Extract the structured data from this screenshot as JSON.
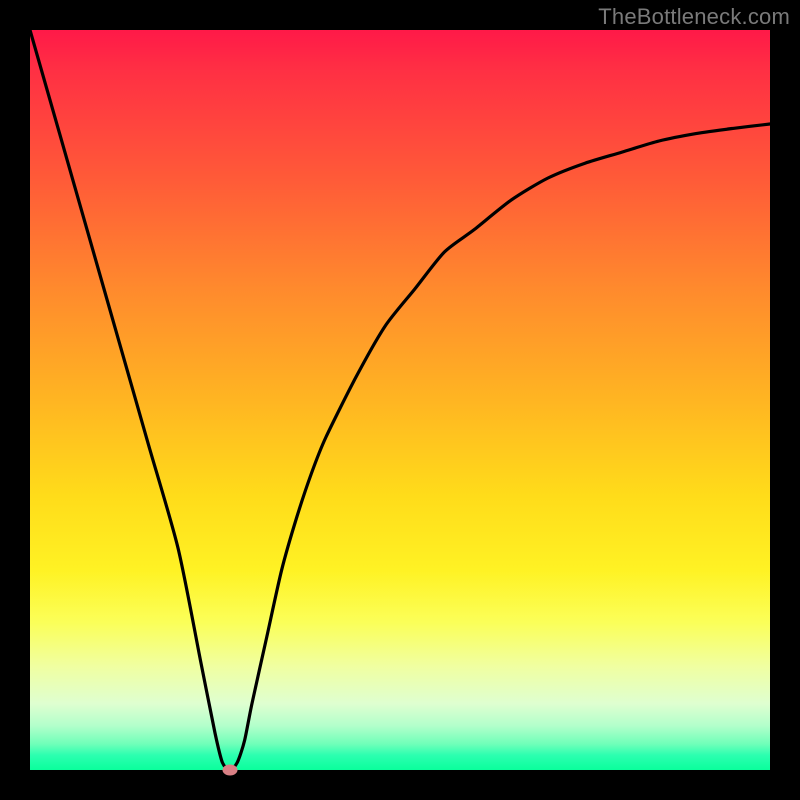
{
  "watermark": "TheBottleneck.com",
  "colors": {
    "frame": "#000000",
    "curve_stroke": "#000000",
    "dot_fill": "#d98085",
    "gradient_stops": [
      "#ff1948",
      "#ff2e44",
      "#ff5a38",
      "#ff8a2d",
      "#ffb522",
      "#ffdc1a",
      "#fff224",
      "#fbff58",
      "#f0ffa1",
      "#dfffd0",
      "#b3ffcb",
      "#6fffb9",
      "#2cffb0",
      "#0aff9c"
    ]
  },
  "chart_data": {
    "type": "line",
    "title": "",
    "xlabel": "",
    "ylabel": "",
    "xlim": [
      0,
      100
    ],
    "ylim": [
      0,
      100
    ],
    "series": [
      {
        "name": "bottleneck-curve",
        "x": [
          0,
          4,
          8,
          12,
          16,
          20,
          23,
          25,
          26,
          27,
          28,
          29,
          30,
          32,
          34,
          36,
          38,
          40,
          44,
          48,
          52,
          56,
          60,
          65,
          70,
          75,
          80,
          85,
          90,
          95,
          100
        ],
        "values": [
          100,
          86,
          72,
          58,
          44,
          30,
          15,
          5,
          1,
          0,
          1,
          4,
          9,
          18,
          27,
          34,
          40,
          45,
          53,
          60,
          65,
          70,
          73,
          77,
          80,
          82,
          83.5,
          85,
          86,
          86.7,
          87.3
        ]
      }
    ],
    "annotations": [
      {
        "name": "optimal-point",
        "x": 27,
        "y": 0
      }
    ],
    "grid": false,
    "legend": false
  }
}
